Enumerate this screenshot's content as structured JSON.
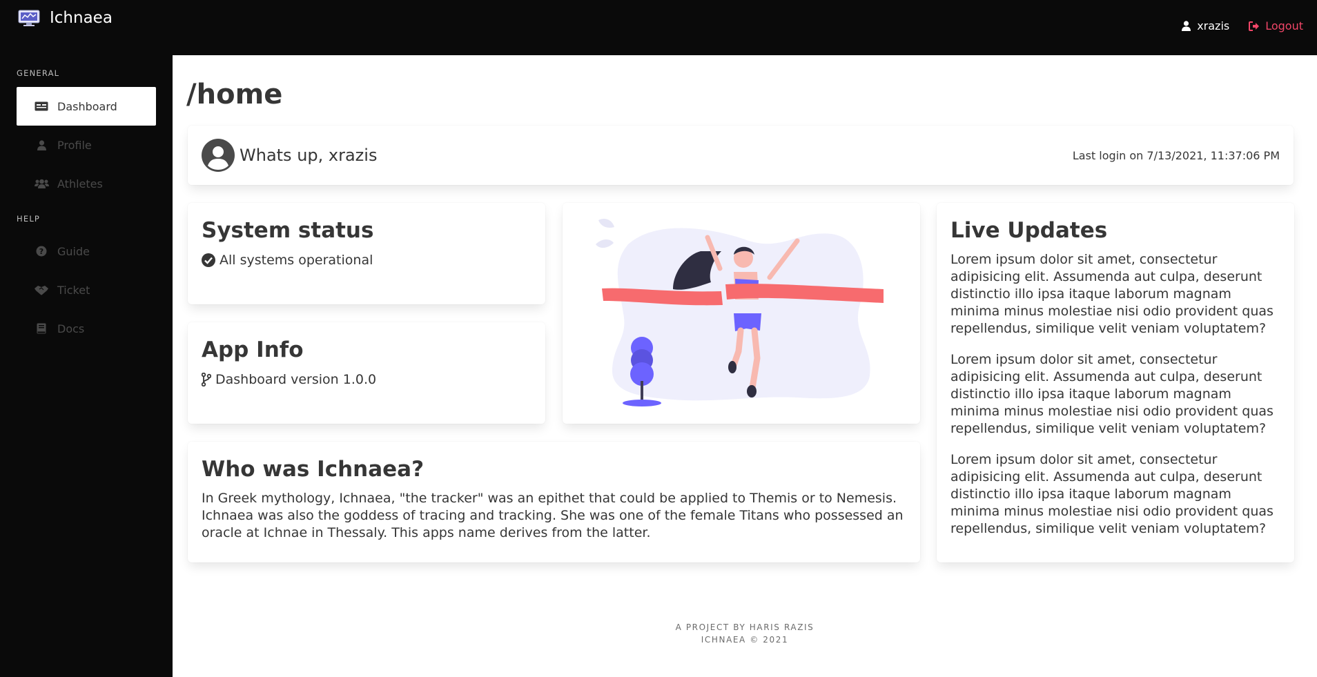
{
  "app": {
    "name": "Ichnaea"
  },
  "nav": {
    "username": "xrazis",
    "logout_label": "Logout"
  },
  "sidebar": {
    "general_label": "GENERAL",
    "help_label": "HELP",
    "items": [
      {
        "label": "Dashboard",
        "icon": "id-card-icon",
        "active": true
      },
      {
        "label": "Profile",
        "icon": "user-icon"
      },
      {
        "label": "Athletes",
        "icon": "users-icon"
      },
      {
        "label": "Guide",
        "icon": "question-circle-icon"
      },
      {
        "label": "Ticket",
        "icon": "handshake-icon"
      },
      {
        "label": "Docs",
        "icon": "book-icon"
      }
    ]
  },
  "page": {
    "title": "/home"
  },
  "welcome": {
    "greeting": "Whats up, xrazis",
    "last_login": "Last login on 7/13/2021, 11:37:06 PM"
  },
  "system_status": {
    "title": "System status",
    "text": "All systems operational"
  },
  "app_info": {
    "title": "App Info",
    "text": "Dashboard version 1.0.0"
  },
  "who": {
    "title": "Who was Ichnaea?",
    "text": "In Greek mythology, Ichnaea, \"the tracker\" was an epithet that could be applied to Themis or to Nemesis. Ichnaea was also the goddess of tracing and tracking. She was one of the female Titans who possessed an oracle at Ichnae in Thessaly. This apps name derives from the latter."
  },
  "live_updates": {
    "title": "Live Updates",
    "paragraphs": [
      "Lorem ipsum dolor sit amet, consectetur adipisicing elit. Assumenda aut culpa, deserunt distinctio illo ipsa itaque laborum magnam minima minus molestiae nisi odio provident quas repellendus, similique velit veniam voluptatem?",
      "Lorem ipsum dolor sit amet, consectetur adipisicing elit. Assumenda aut culpa, deserunt distinctio illo ipsa itaque laborum magnam minima minus molestiae nisi odio provident quas repellendus, similique velit veniam voluptatem?",
      "Lorem ipsum dolor sit amet, consectetur adipisicing elit. Assumenda aut culpa, deserunt distinctio illo ipsa itaque laborum magnam minima minus molestiae nisi odio provident quas repellendus, similique velit veniam voluptatem?"
    ]
  },
  "footer": {
    "line1": "A PROJECT BY HARIS RAZIS",
    "line2": "ICHNAEA © 2021"
  },
  "colors": {
    "accent_logout": "#f14668",
    "illustration_red": "#f76b6e",
    "illustration_purple": "#6c63ff"
  }
}
